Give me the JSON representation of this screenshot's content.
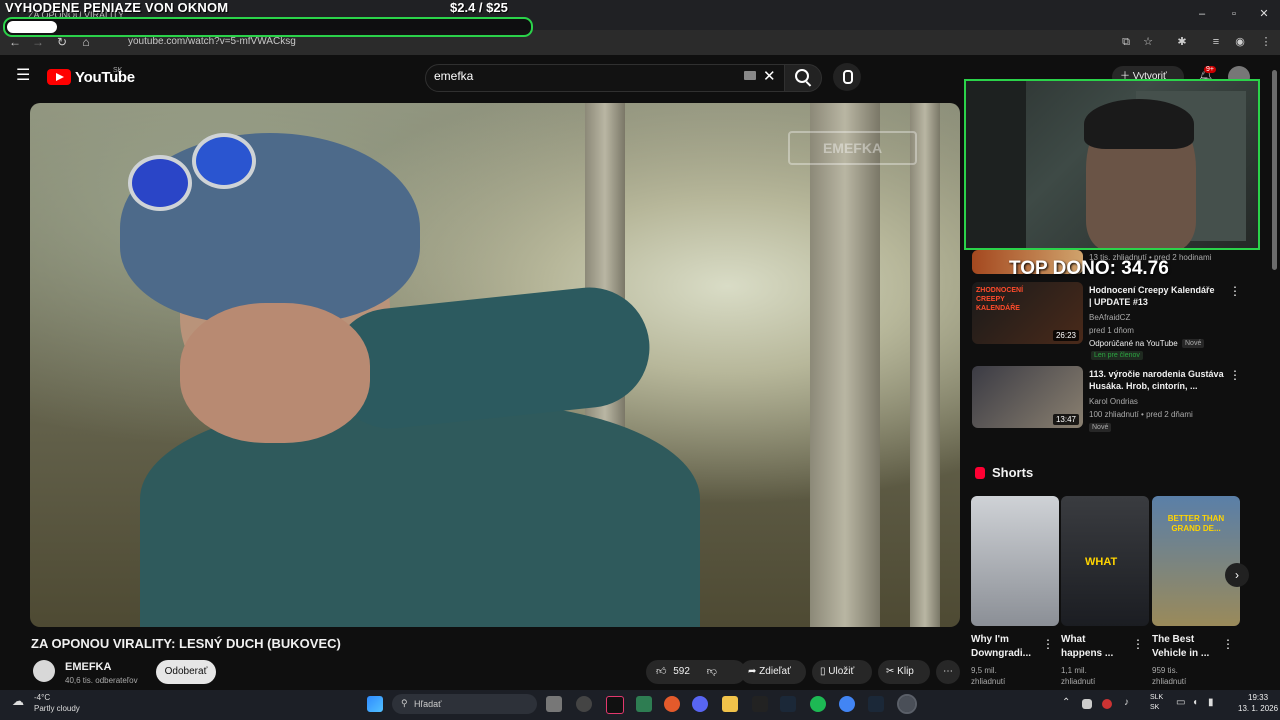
{
  "browser": {
    "tab_title": "ZA OPONOU VIRALITY",
    "url": "youtube.com/watch?v=5-mfVWACksg"
  },
  "overlay": {
    "goal_title": "VYHODENE PENIAZE VON OKNOM",
    "goal_amount": "$2.4  / $25",
    "goal_progress": 0.096,
    "top_dono": "TOP DONO: 34.76"
  },
  "youtube": {
    "logo": "YouTube",
    "region": "SK",
    "search_value": "emefka",
    "create_label": "Vytvoriť",
    "notif_count": "9+"
  },
  "video": {
    "watermark": "EMEFKA",
    "title": "ZA OPONOU VIRALITY: LESNÝ DUCH (BUKOVEC)",
    "channel": "EMEFKA",
    "subscribers": "40,6 tis. odberateľov",
    "subscribe_label": "Odoberať",
    "likes": "592",
    "share_label": "Zdieľať",
    "save_label": "Uložiť",
    "clip_label": "Klip"
  },
  "recommendations": [
    {
      "meta": "13 tis. zhliadnutí • pred 2 hodinami"
    },
    {
      "title": "Hodnocení Creepy Kalendáře | UPDATE #13",
      "channel": "BeAfraidCZ",
      "meta": "pred 1 dňom",
      "extra": "Odporúčané na YouTube",
      "badge": "Nové",
      "members": "Len pre členov",
      "duration": "26:23",
      "thumb_text": "ZHODNOCENÍ CREEPY KALENDÁŘE"
    },
    {
      "title": "113. výročie narodenia Gustáva Husáka. Hrob, cintorín, ...",
      "channel": "Karol Ondrias",
      "meta": "100 zhliadnutí • pred 2 dňami",
      "badge": "Nové",
      "duration": "13:47"
    }
  ],
  "shorts": {
    "label": "Shorts",
    "items": [
      {
        "title": "Why I'm Downgradi...",
        "views1": "9,5 mil.",
        "views2": "zhliadnutí"
      },
      {
        "title": "What happens ...",
        "views1": "1,1 mil.",
        "views2": "zhliadnutí",
        "thumb_text": "WHAT"
      },
      {
        "title": "The Best Vehicle in ...",
        "views1": "959 tis.",
        "views2": "zhliadnutí",
        "thumb_text": "BETTER THAN GRAND DE..."
      }
    ]
  },
  "taskbar": {
    "temp": "-4°C",
    "weather": "Partly cloudy",
    "search_placeholder": "Hľadať",
    "lang1": "SLK",
    "lang2": "SK",
    "time": "19:33",
    "date": "13. 1. 2026"
  },
  "colors": {
    "accent_green": "#2bd34a",
    "youtube_red": "#ff0000"
  }
}
